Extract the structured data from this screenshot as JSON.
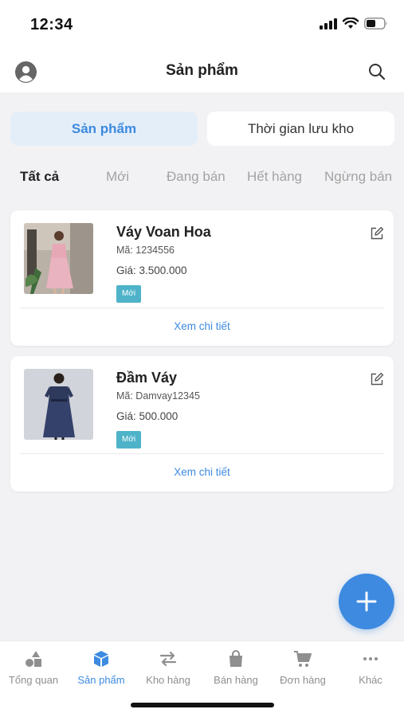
{
  "status_bar": {
    "time": "12:34"
  },
  "header": {
    "title": "Sản phẩm",
    "left_icon": "user-avatar-icon",
    "right_icon": "search-icon"
  },
  "segments": [
    {
      "label": "Sản phẩm",
      "active": true
    },
    {
      "label": "Thời gian lưu kho",
      "active": false
    }
  ],
  "filters": [
    {
      "label": "Tất cả",
      "active": true
    },
    {
      "label": "Mới",
      "active": false
    },
    {
      "label": "Đang bán",
      "active": false
    },
    {
      "label": "Hết hàng",
      "active": false
    },
    {
      "label": "Ngừng bán",
      "active": false
    }
  ],
  "products": [
    {
      "name": "Váy Voan Hoa",
      "code": "Mã: 1234556",
      "price": "Giá: 3.500.000",
      "badge": "Mới",
      "detail_link": "Xem chi tiết"
    },
    {
      "name": "Đầm Váy",
      "code": "Mã: Damvay12345",
      "price": "Giá: 500.000",
      "badge": "Mới",
      "detail_link": "Xem chi tiết"
    }
  ],
  "fab": {
    "icon": "plus-icon"
  },
  "tabbar": [
    {
      "label": "Tổng quan",
      "icon": "shapes-icon",
      "active": false
    },
    {
      "label": "Sản phẩm",
      "icon": "box-icon",
      "active": true
    },
    {
      "label": "Kho hàng",
      "icon": "transfer-arrows-icon",
      "active": false
    },
    {
      "label": "Bán hàng",
      "icon": "shopping-bag-icon",
      "active": false
    },
    {
      "label": "Đơn hàng",
      "icon": "cart-icon",
      "active": false
    },
    {
      "label": "Khác",
      "icon": "more-dots-icon",
      "active": false
    }
  ],
  "colors": {
    "accent": "#3d8ae0",
    "badge": "#4eb3c9",
    "background": "#f2f2f4",
    "inactive": "#8f8f8f"
  }
}
